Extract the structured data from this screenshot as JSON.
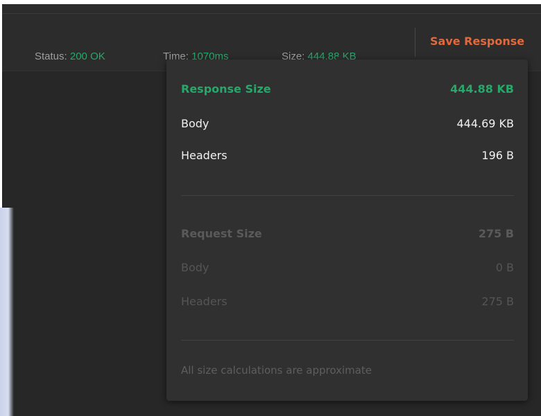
{
  "statusbar": {
    "status_label": "Status:",
    "status_value": "200 OK",
    "time_label": "Time:",
    "time_value": "1070ms",
    "size_label": "Size:",
    "size_value": "444.88 KB",
    "save_label": "Save Response"
  },
  "popover": {
    "response": {
      "title": "Response Size",
      "total": "444.88 KB",
      "body_label": "Body",
      "body_value": "444.69 KB",
      "headers_label": "Headers",
      "headers_value": "196 B"
    },
    "request": {
      "title": "Request Size",
      "total": "275 B",
      "body_label": "Body",
      "body_value": "0 B",
      "headers_label": "Headers",
      "headers_value": "275 B"
    },
    "footnote": "All size calculations are approximate"
  },
  "colors": {
    "accent_green": "#27a86a",
    "accent_orange": "#e06a3d",
    "background": "#272727",
    "popover": "#303030"
  }
}
